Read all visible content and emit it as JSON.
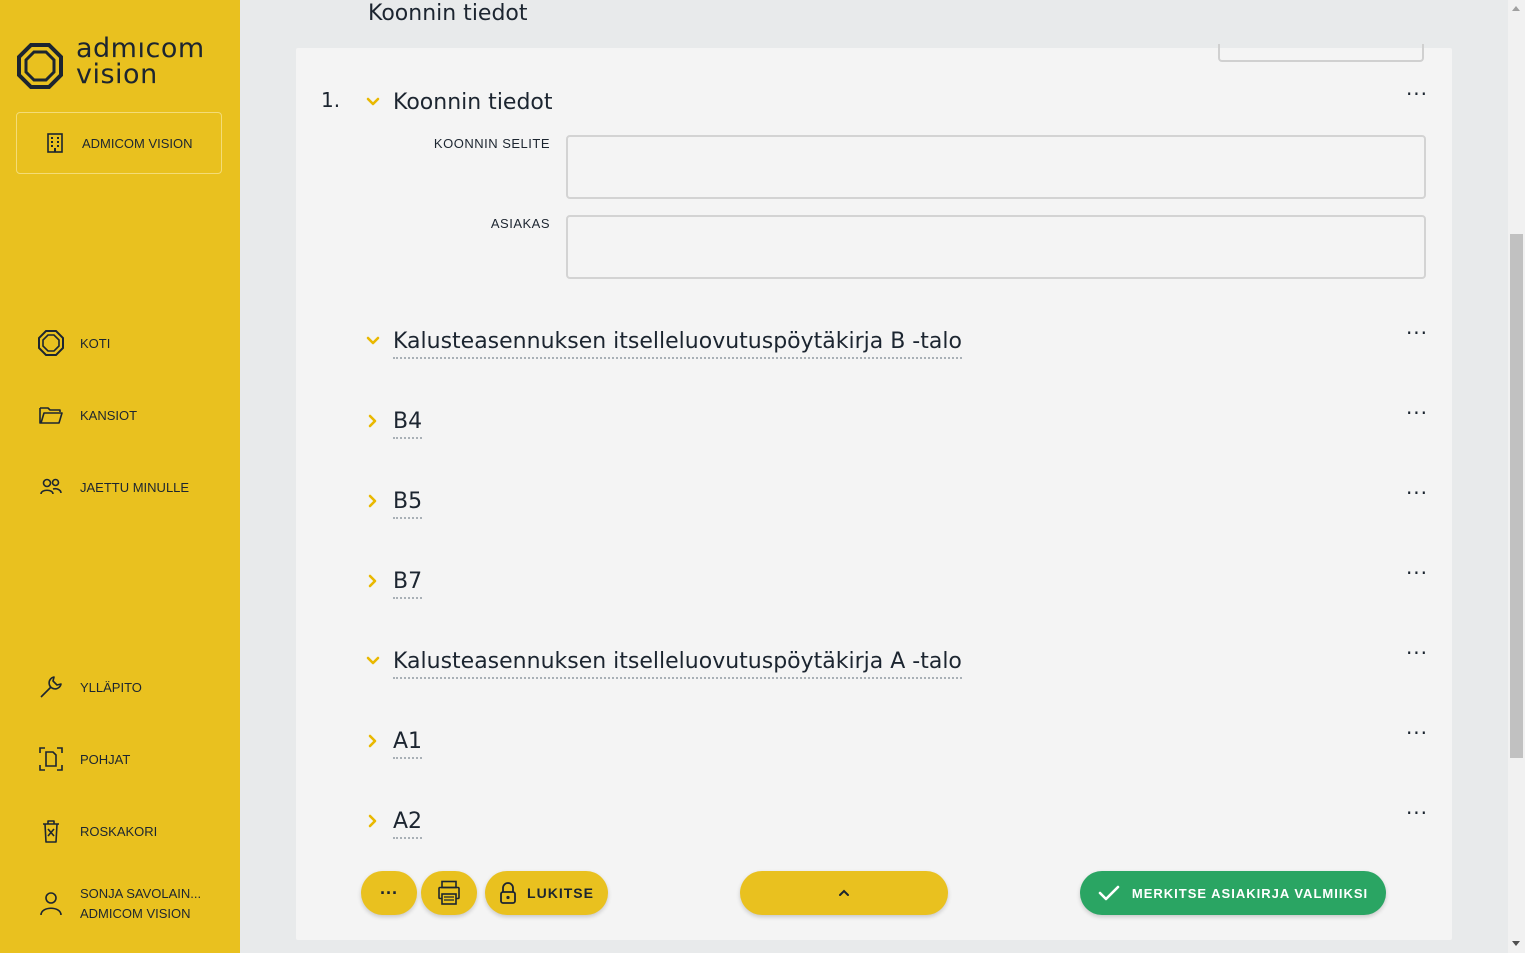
{
  "brand": {
    "logo_text_line1": "admıcom",
    "logo_text_line2": "vision"
  },
  "sidebar": {
    "workspace_label": "ADMICOM VISION",
    "nav_top": [
      {
        "label": "KOTI",
        "icon": "home-octagon-icon"
      },
      {
        "label": "KANSIOT",
        "icon": "folder-icon"
      },
      {
        "label": "JAETTU MINULLE",
        "icon": "users-icon"
      }
    ],
    "nav_bottom": [
      {
        "label": "YLLÄPITO",
        "icon": "wrench-icon"
      },
      {
        "label": "POHJAT",
        "icon": "template-icon"
      },
      {
        "label": "ROSKAKORI",
        "icon": "trash-icon"
      }
    ],
    "user": {
      "name": "SONJA SAVOLAIN...",
      "org": "ADMICOM VISION"
    }
  },
  "header": {
    "title": "Koonnin tiedot"
  },
  "document": {
    "section_number": "1.",
    "section_title": "Koonnin tiedot",
    "fields": [
      {
        "label": "KOONNIN SELITE",
        "value": ""
      },
      {
        "label": "ASIAKAS",
        "value": ""
      }
    ],
    "items": [
      {
        "title": "Kalusteasennuksen itselleluovutuspöytäkirja B -talo",
        "expanded": true
      },
      {
        "title": "B4",
        "expanded": false
      },
      {
        "title": "B5",
        "expanded": false
      },
      {
        "title": "B7",
        "expanded": false
      },
      {
        "title": "Kalusteasennuksen itselleluovutuspöytäkirja A -talo",
        "expanded": true
      },
      {
        "title": "A1",
        "expanded": false
      },
      {
        "title": "A2",
        "expanded": false
      }
    ],
    "more_label": "···"
  },
  "toolbar": {
    "more_label": "···",
    "lock_label": "LUKITSE",
    "done_label": "MERKITSE ASIAKIRJA VALMIIKSI"
  },
  "colors": {
    "brand_yellow": "#e9c11f",
    "success_green": "#2aa563",
    "text_dark": "#1c2530",
    "panel_bg": "#f4f4f4"
  }
}
